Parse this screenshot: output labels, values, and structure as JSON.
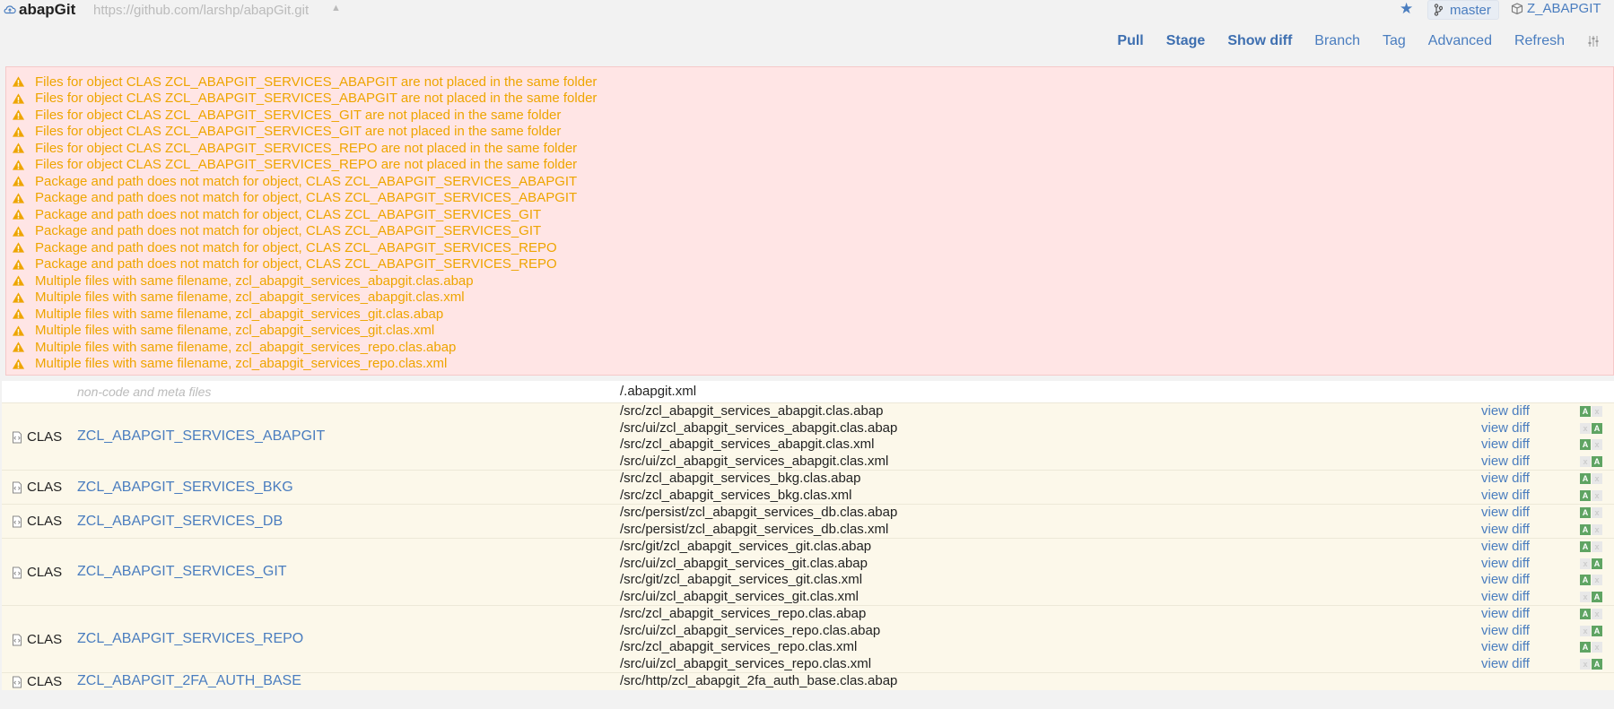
{
  "header": {
    "app_title": "abapGit",
    "repo_url": "https://github.com/larshp/abapGit.git",
    "branch": "master",
    "package": "Z_ABAPGIT"
  },
  "toolbar": {
    "pull": "Pull",
    "stage": "Stage",
    "show_diff": "Show diff",
    "branch": "Branch",
    "tag": "Tag",
    "advanced": "Advanced",
    "refresh": "Refresh"
  },
  "warnings": [
    "Files for object CLAS ZCL_ABAPGIT_SERVICES_ABAPGIT are not placed in the same folder",
    "Files for object CLAS ZCL_ABAPGIT_SERVICES_ABAPGIT are not placed in the same folder",
    "Files for object CLAS ZCL_ABAPGIT_SERVICES_GIT are not placed in the same folder",
    "Files for object CLAS ZCL_ABAPGIT_SERVICES_GIT are not placed in the same folder",
    "Files for object CLAS ZCL_ABAPGIT_SERVICES_REPO are not placed in the same folder",
    "Files for object CLAS ZCL_ABAPGIT_SERVICES_REPO are not placed in the same folder",
    "Package and path does not match for object, CLAS ZCL_ABAPGIT_SERVICES_ABAPGIT",
    "Package and path does not match for object, CLAS ZCL_ABAPGIT_SERVICES_ABAPGIT",
    "Package and path does not match for object, CLAS ZCL_ABAPGIT_SERVICES_GIT",
    "Package and path does not match for object, CLAS ZCL_ABAPGIT_SERVICES_GIT",
    "Package and path does not match for object, CLAS ZCL_ABAPGIT_SERVICES_REPO",
    "Package and path does not match for object, CLAS ZCL_ABAPGIT_SERVICES_REPO",
    "Multiple files with same filename, zcl_abapgit_services_abapgit.clas.abap",
    "Multiple files with same filename, zcl_abapgit_services_abapgit.clas.xml",
    "Multiple files with same filename, zcl_abapgit_services_git.clas.abap",
    "Multiple files with same filename, zcl_abapgit_services_git.clas.xml",
    "Multiple files with same filename, zcl_abapgit_services_repo.clas.abap",
    "Multiple files with same filename, zcl_abapgit_services_repo.clas.xml"
  ],
  "meta_row": {
    "label": "non-code and meta files",
    "file": "/.abapgit.xml"
  },
  "view_diff_label": "view diff",
  "objects": [
    {
      "type": "CLAS",
      "name": "ZCL_ABAPGIT_SERVICES_ABAPGIT",
      "files": [
        {
          "path": "/src/zcl_abapgit_services_abapgit.clas.abap",
          "state": [
            "A",
            "x"
          ]
        },
        {
          "path": "/src/ui/zcl_abapgit_services_abapgit.clas.abap",
          "state": [
            "x",
            "A"
          ]
        },
        {
          "path": "/src/zcl_abapgit_services_abapgit.clas.xml",
          "state": [
            "A",
            "x"
          ]
        },
        {
          "path": "/src/ui/zcl_abapgit_services_abapgit.clas.xml",
          "state": [
            "x",
            "A"
          ]
        }
      ]
    },
    {
      "type": "CLAS",
      "name": "ZCL_ABAPGIT_SERVICES_BKG",
      "files": [
        {
          "path": "/src/zcl_abapgit_services_bkg.clas.abap",
          "state": [
            "A",
            "x"
          ]
        },
        {
          "path": "/src/zcl_abapgit_services_bkg.clas.xml",
          "state": [
            "A",
            "x"
          ]
        }
      ]
    },
    {
      "type": "CLAS",
      "name": "ZCL_ABAPGIT_SERVICES_DB",
      "files": [
        {
          "path": "/src/persist/zcl_abapgit_services_db.clas.abap",
          "state": [
            "A",
            "x"
          ]
        },
        {
          "path": "/src/persist/zcl_abapgit_services_db.clas.xml",
          "state": [
            "A",
            "x"
          ]
        }
      ]
    },
    {
      "type": "CLAS",
      "name": "ZCL_ABAPGIT_SERVICES_GIT",
      "files": [
        {
          "path": "/src/git/zcl_abapgit_services_git.clas.abap",
          "state": [
            "A",
            "x"
          ]
        },
        {
          "path": "/src/ui/zcl_abapgit_services_git.clas.abap",
          "state": [
            "x",
            "A"
          ]
        },
        {
          "path": "/src/git/zcl_abapgit_services_git.clas.xml",
          "state": [
            "A",
            "x"
          ]
        },
        {
          "path": "/src/ui/zcl_abapgit_services_git.clas.xml",
          "state": [
            "x",
            "A"
          ]
        }
      ]
    },
    {
      "type": "CLAS",
      "name": "ZCL_ABAPGIT_SERVICES_REPO",
      "files": [
        {
          "path": "/src/zcl_abapgit_services_repo.clas.abap",
          "state": [
            "A",
            "x"
          ]
        },
        {
          "path": "/src/ui/zcl_abapgit_services_repo.clas.abap",
          "state": [
            "x",
            "A"
          ]
        },
        {
          "path": "/src/zcl_abapgit_services_repo.clas.xml",
          "state": [
            "A",
            "x"
          ]
        },
        {
          "path": "/src/ui/zcl_abapgit_services_repo.clas.xml",
          "state": [
            "x",
            "A"
          ]
        }
      ]
    },
    {
      "type": "CLAS",
      "name": "ZCL_ABAPGIT_2FA_AUTH_BASE",
      "files": [
        {
          "path": "/src/http/zcl_abapgit_2fa_auth_base.clas.abap",
          "state": []
        }
      ]
    }
  ]
}
